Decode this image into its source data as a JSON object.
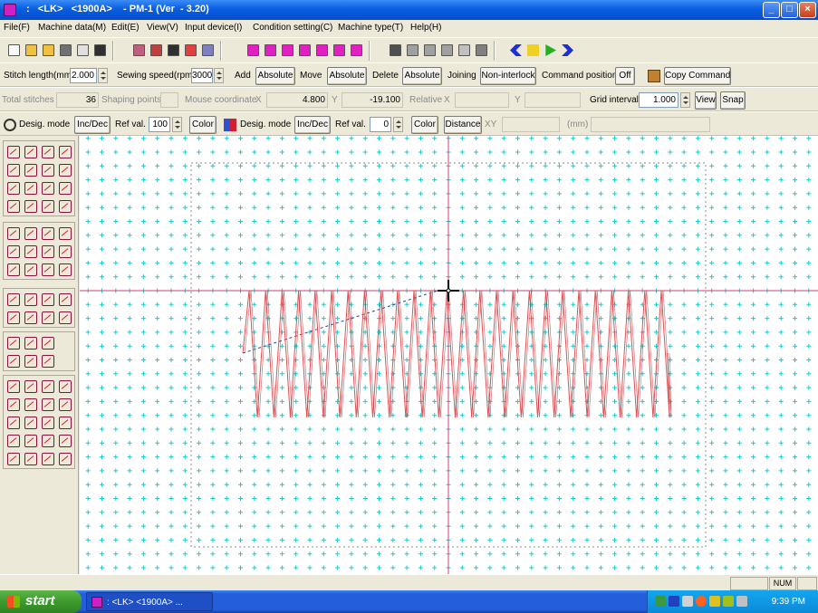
{
  "window": {
    "title": " :   <LK>   <1900A>    - PM-1 (Ver  - 3.20)",
    "controls": {
      "minimize": "_",
      "maximize": "□",
      "close": "×"
    }
  },
  "menu": [
    "File(F)",
    "Machine data(M)",
    "Edit(E)",
    "View(V)",
    "Input device(I)",
    "Condition setting(C)",
    "Machine type(T)",
    "Help(H)"
  ],
  "toolbar": {
    "groups": [
      [
        "new-file-icon",
        "open-folder-icon",
        "open-icon",
        "print-icon",
        "print-preview-icon",
        "save-icon"
      ],
      [
        "pen-icon",
        "pattern-icon",
        "grid-icon",
        "bmp-icon",
        "window-icon"
      ],
      [
        "layer1-icon",
        "layer2-icon",
        "layer3-icon",
        "layer4-icon",
        "layer5-icon",
        "layer6-icon",
        "layer7-icon"
      ],
      [
        "cut-icon",
        "copy-icon",
        "paste-icon",
        "undo-icon",
        "redo-icon",
        "select-all-icon"
      ],
      [
        "rewind-icon",
        "pause-icon",
        "play-icon",
        "fast-forward-icon"
      ]
    ]
  },
  "row2": {
    "stitch_length_label": "Stitch length(mm)",
    "stitch_length_value": "2.000",
    "sewing_speed_label": "Sewing speed(rpm)",
    "sewing_speed_value": "3000",
    "add_label": "Add",
    "add_mode": "Absolute",
    "move_label": "Move",
    "move_mode": "Absolute",
    "delete_label": "Delete",
    "delete_mode": "Absolute",
    "joining_label": "Joining",
    "joining_mode": "Non-interlock",
    "command_position_label": "Command position",
    "command_position_value": "Off",
    "copy_command_label": "Copy Command"
  },
  "row3": {
    "total_stitches_label": "Total stitches",
    "total_stitches_value": "36",
    "shaping_points_label": "Shaping points",
    "shaping_points_value": "",
    "mouse_coordinate_label": "Mouse coordinate",
    "x_label": "X",
    "x_value": "4.800",
    "y_label": "Y",
    "y_value": "-19.100",
    "relative_label": "Relative",
    "rel_x_label": "X",
    "rel_x_value": "",
    "rel_y_label": "Y",
    "rel_y_value": "",
    "grid_interval_label": "Grid interval",
    "grid_interval_value": "1.000",
    "view_label": "View",
    "snap_label": "Snap"
  },
  "row4": {
    "desig_mode_label": "Desig. mode",
    "incdec_label": "Inc/Dec",
    "ref_val_label": "Ref val.",
    "ref_val_value": "100",
    "color_label": "Color",
    "desig_mode_label_2": "Desig. mode",
    "incdec_label_2": "Inc/Dec",
    "ref_val_label_2": "Ref val.",
    "ref_val_value_2": "0",
    "color_label_2": "Color",
    "distance_label": "Distance",
    "xy_label": "XY",
    "xy_value": "",
    "mm_label": "(mm)",
    "mm_value": ""
  },
  "palette_groups": [
    {
      "rows": 4,
      "cols": 4
    },
    {
      "rows": 3,
      "cols": 4
    },
    {
      "rows": 2,
      "cols": 4
    },
    {
      "rows": 2,
      "cols": 3
    },
    {
      "rows": 5,
      "cols": 4
    }
  ],
  "canvas": {
    "grid_color": "#1ec8c8",
    "axis_color": "#d04070",
    "stitch_color": "#e05050",
    "frame_color": "#888888"
  },
  "status": {
    "num": "NUM"
  },
  "taskbar": {
    "start_label": "start",
    "task_label": " :   <LK>   <1900A>   ...",
    "clock": "9:39 PM"
  }
}
